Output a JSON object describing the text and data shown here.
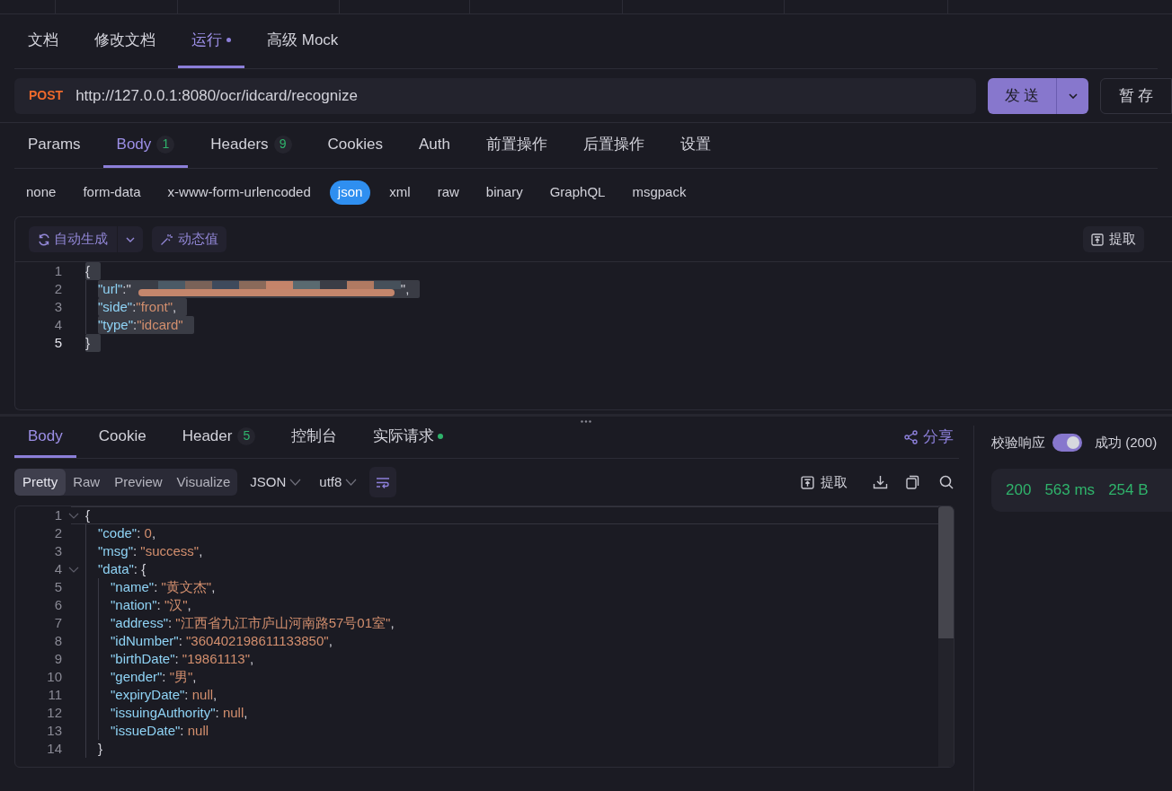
{
  "doc_tabs": [
    {
      "label": "文档",
      "selected": false,
      "modified": false
    },
    {
      "label": "修改文档",
      "selected": false,
      "modified": false
    },
    {
      "label": "运行",
      "selected": true,
      "modified": true
    },
    {
      "label": "高级 Mock",
      "selected": false,
      "modified": false
    }
  ],
  "request": {
    "method": "POST",
    "url": "http://127.0.0.1:8080/ocr/idcard/recognize",
    "send": "发 送",
    "save": "暂 存"
  },
  "param_tabs": [
    {
      "label": "Params",
      "selected": false
    },
    {
      "label": "Body",
      "badge": "1",
      "selected": true
    },
    {
      "label": "Headers",
      "badge": "9",
      "selected": false
    },
    {
      "label": "Cookies",
      "selected": false
    },
    {
      "label": "Auth",
      "selected": false
    },
    {
      "label": "前置操作",
      "selected": false
    },
    {
      "label": "后置操作",
      "selected": false
    },
    {
      "label": "设置",
      "selected": false
    }
  ],
  "body_types": [
    {
      "label": "none",
      "selected": false
    },
    {
      "label": "form-data",
      "selected": false
    },
    {
      "label": "x-www-form-urlencoded",
      "selected": false
    },
    {
      "label": "json",
      "selected": true
    },
    {
      "label": "xml",
      "selected": false
    },
    {
      "label": "raw",
      "selected": false
    },
    {
      "label": "binary",
      "selected": false
    },
    {
      "label": "GraphQL",
      "selected": false
    },
    {
      "label": "msgpack",
      "selected": false
    }
  ],
  "body_editor": {
    "auto_generate": "自动生成",
    "dynamic_value": "动态值",
    "extract": "提取",
    "lines": [
      {
        "number": "1",
        "selected": true,
        "current": false,
        "tokens": [
          {
            "kind": "punct",
            "text": "{"
          }
        ],
        "children": [
          {
            "number": "2",
            "selected": true,
            "current": false,
            "tokens": [
              {
                "kind": "key",
                "text": "\"url\""
              },
              {
                "kind": "punct",
                "text": ":\""
              },
              {
                "kind": "redacted"
              },
              {
                "kind": "punct",
                "text": "\","
              }
            ]
          },
          {
            "number": "3",
            "selected": true,
            "current": false,
            "tokens": [
              {
                "kind": "key",
                "text": "\"side\""
              },
              {
                "kind": "punct",
                "text": ":"
              },
              {
                "kind": "string",
                "text": "\"front\""
              },
              {
                "kind": "punct",
                "text": ","
              }
            ]
          },
          {
            "number": "4",
            "selected": true,
            "current": false,
            "tokens": [
              {
                "kind": "key",
                "text": "\"type\""
              },
              {
                "kind": "punct",
                "text": ":"
              },
              {
                "kind": "string",
                "text": "\"idcard\""
              }
            ]
          }
        ]
      },
      {
        "number": "5",
        "selected": true,
        "current": true,
        "tokens": [
          {
            "kind": "punct",
            "text": "}"
          }
        ]
      }
    ]
  },
  "response": {
    "tabs": [
      {
        "label": "Body",
        "selected": true,
        "dot": false
      },
      {
        "label": "Cookie",
        "selected": false,
        "dot": false
      },
      {
        "label": "Header",
        "badge": "5",
        "selected": false,
        "dot": false
      },
      {
        "label": "控制台",
        "selected": false,
        "dot": false
      },
      {
        "label": "实际请求",
        "selected": false,
        "dot": true
      }
    ],
    "share": "分享",
    "views": [
      {
        "label": "Pretty",
        "selected": true
      },
      {
        "label": "Raw",
        "selected": false
      },
      {
        "label": "Preview",
        "selected": false
      },
      {
        "label": "Visualize",
        "selected": false
      }
    ],
    "format": "JSON",
    "encoding": "utf8",
    "extract": "提取",
    "lines": [
      {
        "number": "1",
        "foldable": true,
        "tokens": [
          {
            "kind": "punct",
            "text": "{"
          }
        ],
        "children": [
          {
            "number": "2",
            "foldable": false,
            "tokens": [
              {
                "kind": "key",
                "text": "\"code\""
              },
              {
                "kind": "punct",
                "text": ": "
              },
              {
                "kind": "number",
                "text": "0"
              },
              {
                "kind": "punct",
                "text": ","
              }
            ]
          },
          {
            "number": "3",
            "foldable": false,
            "tokens": [
              {
                "kind": "key",
                "text": "\"msg\""
              },
              {
                "kind": "punct",
                "text": ": "
              },
              {
                "kind": "string",
                "text": "\"success\""
              },
              {
                "kind": "punct",
                "text": ","
              }
            ]
          },
          {
            "number": "4",
            "foldable": true,
            "tokens": [
              {
                "kind": "key",
                "text": "\"data\""
              },
              {
                "kind": "punct",
                "text": ": {"
              }
            ],
            "children": [
              {
                "number": "5",
                "foldable": false,
                "tokens": [
                  {
                    "kind": "key",
                    "text": "\"name\""
                  },
                  {
                    "kind": "punct",
                    "text": ": "
                  },
                  {
                    "kind": "string",
                    "text": "\"黄文杰\""
                  },
                  {
                    "kind": "punct",
                    "text": ","
                  }
                ]
              },
              {
                "number": "6",
                "foldable": false,
                "tokens": [
                  {
                    "kind": "key",
                    "text": "\"nation\""
                  },
                  {
                    "kind": "punct",
                    "text": ": "
                  },
                  {
                    "kind": "string",
                    "text": "\"汉\""
                  },
                  {
                    "kind": "punct",
                    "text": ","
                  }
                ]
              },
              {
                "number": "7",
                "foldable": false,
                "tokens": [
                  {
                    "kind": "key",
                    "text": "\"address\""
                  },
                  {
                    "kind": "punct",
                    "text": ": "
                  },
                  {
                    "kind": "string",
                    "text": "\"江西省九江市庐山河南路57号01室\""
                  },
                  {
                    "kind": "punct",
                    "text": ","
                  }
                ]
              },
              {
                "number": "8",
                "foldable": false,
                "tokens": [
                  {
                    "kind": "key",
                    "text": "\"idNumber\""
                  },
                  {
                    "kind": "punct",
                    "text": ": "
                  },
                  {
                    "kind": "string",
                    "text": "\"360402198611133850\""
                  },
                  {
                    "kind": "punct",
                    "text": ","
                  }
                ]
              },
              {
                "number": "9",
                "foldable": false,
                "tokens": [
                  {
                    "kind": "key",
                    "text": "\"birthDate\""
                  },
                  {
                    "kind": "punct",
                    "text": ": "
                  },
                  {
                    "kind": "string",
                    "text": "\"19861113\""
                  },
                  {
                    "kind": "punct",
                    "text": ","
                  }
                ]
              },
              {
                "number": "10",
                "foldable": false,
                "tokens": [
                  {
                    "kind": "key",
                    "text": "\"gender\""
                  },
                  {
                    "kind": "punct",
                    "text": ": "
                  },
                  {
                    "kind": "string",
                    "text": "\"男\""
                  },
                  {
                    "kind": "punct",
                    "text": ","
                  }
                ]
              },
              {
                "number": "11",
                "foldable": false,
                "tokens": [
                  {
                    "kind": "key",
                    "text": "\"expiryDate\""
                  },
                  {
                    "kind": "punct",
                    "text": ": "
                  },
                  {
                    "kind": "number",
                    "text": "null"
                  },
                  {
                    "kind": "punct",
                    "text": ","
                  }
                ]
              },
              {
                "number": "12",
                "foldable": false,
                "tokens": [
                  {
                    "kind": "key",
                    "text": "\"issuingAuthority\""
                  },
                  {
                    "kind": "punct",
                    "text": ": "
                  },
                  {
                    "kind": "number",
                    "text": "null"
                  },
                  {
                    "kind": "punct",
                    "text": ","
                  }
                ]
              },
              {
                "number": "13",
                "foldable": false,
                "tokens": [
                  {
                    "kind": "key",
                    "text": "\"issueDate\""
                  },
                  {
                    "kind": "punct",
                    "text": ": "
                  },
                  {
                    "kind": "number",
                    "text": "null"
                  }
                ]
              }
            ]
          },
          {
            "number": "14",
            "foldable": false,
            "tokens": [
              {
                "kind": "punct",
                "text": "}"
              }
            ]
          }
        ]
      }
    ]
  },
  "validation": {
    "label": "校验响应",
    "on": true,
    "result": "成功 (200)"
  },
  "stats": [
    "200",
    "563 ms",
    "254 B"
  ]
}
